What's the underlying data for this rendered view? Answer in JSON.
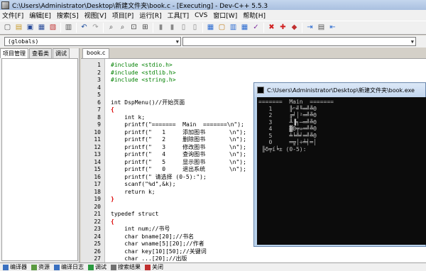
{
  "window": {
    "title": "C:\\Users\\Administrator\\Desktop\\新建文件夹\\book.c - [Executing] - Dev-C++ 5.5.3"
  },
  "menu": [
    "文件[F]",
    "编辑[E]",
    "搜索[S]",
    "视图[V]",
    "项目[P]",
    "运行[R]",
    "工具[T]",
    "CVS",
    "窗口[W]",
    "帮助[H]"
  ],
  "combos": {
    "scope": "(globals)",
    "member": ""
  },
  "left_panel": {
    "tabs": [
      "项目管理",
      "查看类",
      "调试"
    ]
  },
  "editor": {
    "tab": "book.c",
    "lines": [
      {
        "n": "1",
        "t": "#include <stdio.h>",
        "style": "pp"
      },
      {
        "n": "2",
        "t": "#include <stdlib.h>",
        "style": "pp"
      },
      {
        "n": "3",
        "t": "#include <string.h>",
        "style": "pp"
      },
      {
        "n": "4",
        "t": "",
        "style": ""
      },
      {
        "n": "5",
        "t": "",
        "style": ""
      },
      {
        "n": "6",
        "t": "int DspMenu()//开始页面",
        "style": ""
      },
      {
        "n": "7",
        "t": "{",
        "style": "brace"
      },
      {
        "n": "8",
        "t": "    int k;",
        "style": ""
      },
      {
        "n": "9",
        "t": "    printf(\"=======  Main  =======\\n\");",
        "style": ""
      },
      {
        "n": "10",
        "t": "    printf(\"   1     添加图书       \\n\");",
        "style": ""
      },
      {
        "n": "11",
        "t": "    printf(\"   2     删除图书       \\n\");",
        "style": ""
      },
      {
        "n": "12",
        "t": "    printf(\"   3     修改图书       \\n\");",
        "style": ""
      },
      {
        "n": "13",
        "t": "    printf(\"   4     查询图书       \\n\");",
        "style": ""
      },
      {
        "n": "14",
        "t": "    printf(\"   5     显示图书       \\n\");",
        "style": ""
      },
      {
        "n": "15",
        "t": "    printf(\"   0     退出系统       \\n\");",
        "style": ""
      },
      {
        "n": "16",
        "t": "    printf(\" 请选择 (0-5):\");",
        "style": ""
      },
      {
        "n": "17",
        "t": "    scanf(\"%d\",&k);",
        "style": ""
      },
      {
        "n": "18",
        "t": "    return k;",
        "style": ""
      },
      {
        "n": "19",
        "t": "}",
        "style": "brace"
      },
      {
        "n": "20",
        "t": "",
        "style": ""
      },
      {
        "n": "21",
        "t": "typedef struct",
        "style": ""
      },
      {
        "n": "22",
        "t": "{",
        "style": "brace"
      },
      {
        "n": "23",
        "t": "    int num;//书号",
        "style": ""
      },
      {
        "n": "24",
        "t": "    char bname[20];//书名",
        "style": ""
      },
      {
        "n": "25",
        "t": "    char wname[5][20];//作者",
        "style": ""
      },
      {
        "n": "26",
        "t": "    char key[10][50];//关键词",
        "style": ""
      },
      {
        "n": "27",
        "t": "    char ...[20];//出版",
        "style": ""
      }
    ]
  },
  "console": {
    "title": "C:\\Users\\Administrator\\Desktop\\新建文件夹\\book.exe",
    "lines": [
      "=======  Main  =======",
      "   1     ╠ⁿ╝╙═╝╩Θ",
      "   2     ╔╛│²═╝╩Θ",
      "   3     ╨▐╕─═╝╩Θ",
      "   4     ▓Θ╤»═╝╩Θ",
      "   5     ╧╘╩╛═╝╩Θ",
      "   0     ═╦│÷╧╡═│",
      " ╟δ╤í╘± (0-5):"
    ]
  },
  "bottom_tabs": [
    "编译器",
    "资源",
    "编译日志",
    "调试",
    "搜索结果",
    "关闭"
  ],
  "colors": {
    "preprocessor": "#008000",
    "brace": "#dd0000",
    "console_bg": "#0c0c0c",
    "console_fg": "#c0c0c0"
  }
}
